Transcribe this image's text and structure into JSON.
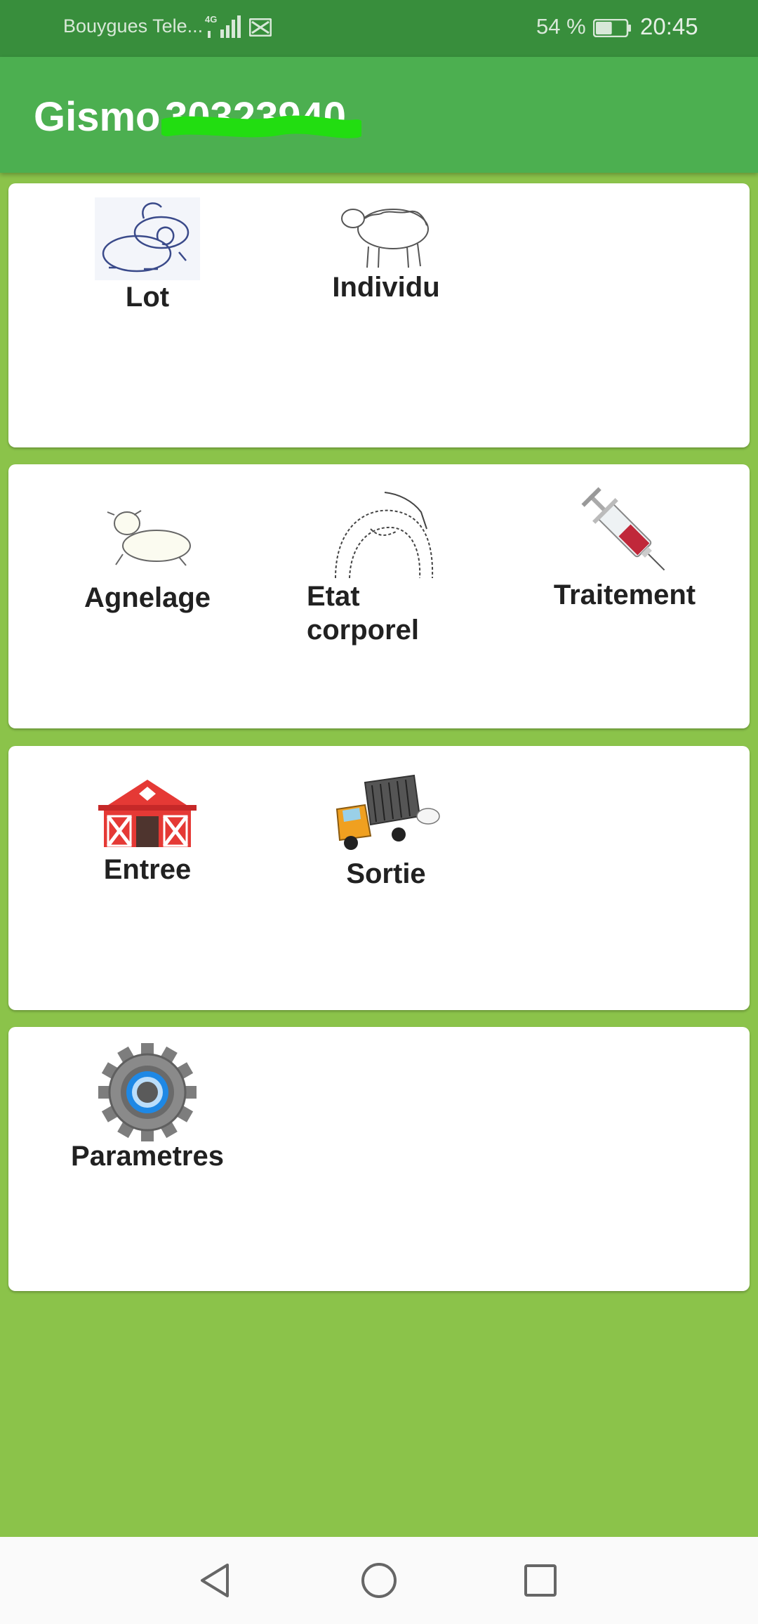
{
  "status_bar": {
    "carrier": "Bouygues Tele...",
    "network": "4G",
    "battery_percent": "54 %",
    "time": "20:45",
    "battery_level": 0.54
  },
  "app_bar": {
    "title": "Gismo",
    "subtitle_redacted": "30323940"
  },
  "cards": [
    {
      "tiles": [
        {
          "label": "Lot",
          "icon": "sheep-lot-icon"
        },
        {
          "label": "Individu",
          "icon": "sheep-individual-icon"
        }
      ]
    },
    {
      "tiles": [
        {
          "label": "Agnelage",
          "icon": "lamb-icon"
        },
        {
          "label_line1": "Etat",
          "label_line2": "corporel",
          "icon": "body-condition-icon"
        },
        {
          "label": "Traitement",
          "icon": "syringe-icon"
        }
      ]
    },
    {
      "tiles": [
        {
          "label": "Entree",
          "icon": "barn-icon"
        },
        {
          "label": "Sortie",
          "icon": "livestock-truck-icon"
        }
      ]
    },
    {
      "tiles": [
        {
          "label": "Parametres",
          "icon": "gear-icon"
        }
      ]
    }
  ],
  "nav_bar": {
    "back": "back-triangle-icon",
    "home": "home-circle-icon",
    "recents": "recents-square-icon"
  },
  "colors": {
    "status_bar": "#388e3c",
    "app_bar": "#4caf50",
    "background": "#8bc34a",
    "card": "#ffffff",
    "redaction": "#22dd11"
  }
}
